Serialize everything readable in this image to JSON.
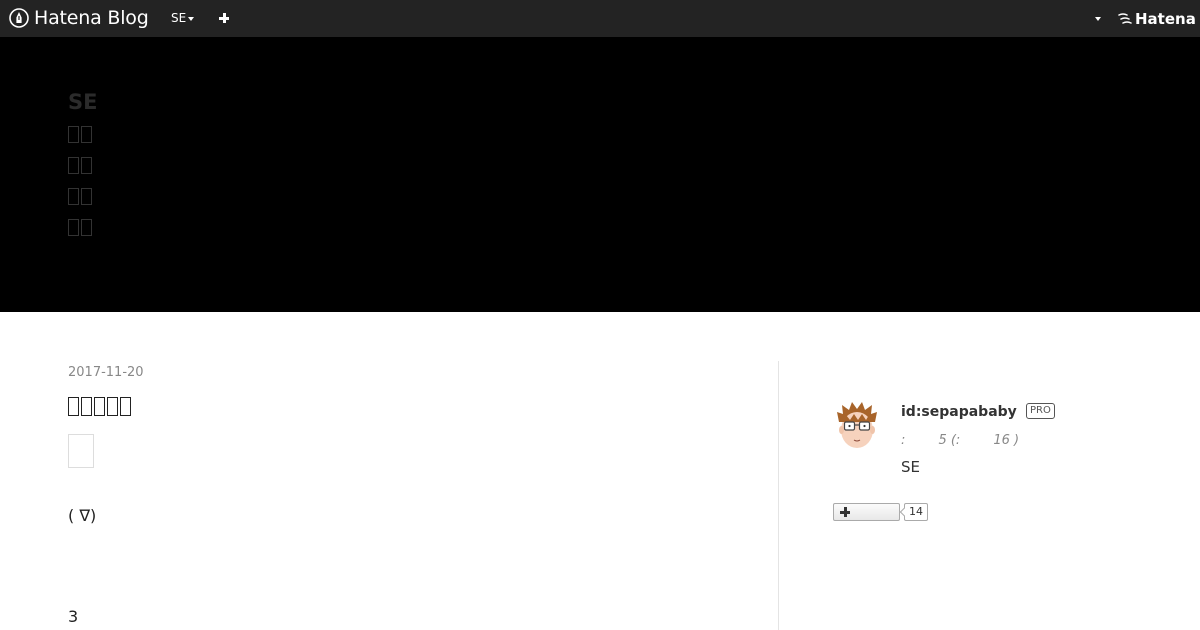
{
  "header": {
    "brand_text": "Hatena Blog",
    "blog_menu_label": "SE",
    "hatena_label": "Hatena"
  },
  "blog": {
    "title": "SE"
  },
  "entry": {
    "date": "2017-11-20",
    "face": "( ∇)",
    "number": "3"
  },
  "profile": {
    "id": "id:sepapababy",
    "badge": "PRO",
    "stats": ":        5 (:        16 )",
    "description": "SE",
    "follow_count": "14"
  }
}
